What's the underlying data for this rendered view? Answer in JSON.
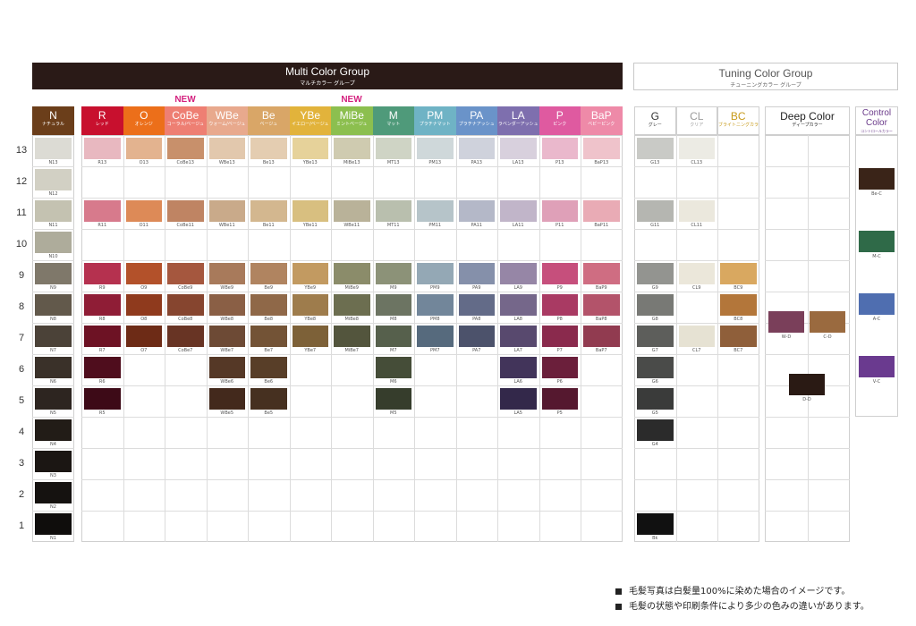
{
  "multi": {
    "title": "Multi Color Group",
    "subtitle": "マルチカラー グループ",
    "groups": [
      {
        "code": "N",
        "jp": "ナチュラル",
        "color": "#6b3e1a",
        "textColor": "#ffffff"
      },
      {
        "code": "R",
        "jp": "レッド",
        "color": "#c8102e",
        "textColor": "#ffffff"
      },
      {
        "code": "O",
        "jp": "オレンジ",
        "color": "#ec6f1a",
        "textColor": "#ffffff"
      },
      {
        "code": "CoBe",
        "jp": "コーラル/ベージュ",
        "color": "#ee7f73",
        "textColor": "#ffffff"
      },
      {
        "code": "WBe",
        "jp": "ウォーム/ベージュ",
        "color": "#e8a98d",
        "textColor": "#ffffff"
      },
      {
        "code": "Be",
        "jp": "ベージュ",
        "color": "#d9a667",
        "textColor": "#ffffff"
      },
      {
        "code": "YBe",
        "jp": "イエロー/ベージュ",
        "color": "#e2b33b",
        "textColor": "#ffffff"
      },
      {
        "code": "MiBe",
        "jp": "ミントベージュ",
        "color": "#8cbf4f",
        "textColor": "#ffffff"
      },
      {
        "code": "M",
        "jp": "マット",
        "color": "#4f9a7a",
        "textColor": "#ffffff"
      },
      {
        "code": "PM",
        "jp": "プラチナマット",
        "color": "#6fb3c5",
        "textColor": "#ffffff"
      },
      {
        "code": "PA",
        "jp": "プラチナアッシュ",
        "color": "#6a93c9",
        "textColor": "#ffffff"
      },
      {
        "code": "LA",
        "jp": "ラベンダーアッシュ",
        "color": "#7e6fae",
        "textColor": "#ffffff"
      },
      {
        "code": "P",
        "jp": "ピンク",
        "color": "#df5aa0",
        "textColor": "#ffffff"
      },
      {
        "code": "BaP",
        "jp": "ベビーピンク",
        "color": "#ee8aa8",
        "textColor": "#ffffff"
      }
    ],
    "new_labels": [
      "NEW",
      "NEW"
    ],
    "rows": [
      {
        "level": "13",
        "cells": [
          {
            "label": "N13",
            "color": "#dcdbd4"
          },
          {
            "label": "R13",
            "color": "#e8b8c0"
          },
          {
            "label": "O13",
            "color": "#e3b38f"
          },
          {
            "label": "CoBe13",
            "color": "#c8906b"
          },
          {
            "label": "WBe13",
            "color": "#e2c8ad"
          },
          {
            "label": "Be13",
            "color": "#e4cdb1"
          },
          {
            "label": "YBe13",
            "color": "#e6d29a"
          },
          {
            "label": "MiBe13",
            "color": "#cfcbb0"
          },
          {
            "label": "MT13",
            "color": "#cfd4c5"
          },
          {
            "label": "PM13",
            "color": "#cfd8da"
          },
          {
            "label": "PA13",
            "color": "#cfd2dc"
          },
          {
            "label": "LA13",
            "color": "#d8d0dd"
          },
          {
            "label": "P13",
            "color": "#eab8cc"
          },
          {
            "label": "BaP13",
            "color": "#efc3cb"
          }
        ]
      },
      {
        "level": "12",
        "cells": [
          {
            "label": "N12",
            "color": "#d2d0c4"
          },
          null,
          null,
          null,
          null,
          null,
          null,
          null,
          null,
          null,
          null,
          null,
          null,
          null
        ]
      },
      {
        "level": "11",
        "cells": [
          {
            "label": "N11",
            "color": "#c4c2b1"
          },
          {
            "label": "R11",
            "color": "#d77a8c"
          },
          {
            "label": "O11",
            "color": "#dd8a57"
          },
          {
            "label": "CoBe11",
            "color": "#bf8463"
          },
          {
            "label": "WBe11",
            "color": "#c9aa8a"
          },
          {
            "label": "Be11",
            "color": "#d3b78f"
          },
          {
            "label": "YBe11",
            "color": "#d8bf80"
          },
          {
            "label": "WBe11",
            "color": "#b9b299"
          },
          {
            "label": "MT11",
            "color": "#b9bfae"
          },
          {
            "label": "PM11",
            "color": "#b6c4c9"
          },
          {
            "label": "PA11",
            "color": "#b4b8c8"
          },
          {
            "label": "LA11",
            "color": "#c1b5c9"
          },
          {
            "label": "P11",
            "color": "#dfa0b8"
          },
          {
            "label": "BaP11",
            "color": "#e9abb5"
          }
        ]
      },
      {
        "level": "10",
        "cells": [
          {
            "label": "N10",
            "color": "#aeac9b"
          },
          null,
          null,
          null,
          null,
          null,
          null,
          null,
          null,
          null,
          null,
          null,
          null,
          null
        ]
      },
      {
        "level": "9",
        "cells": [
          {
            "label": "N9",
            "color": "#7f786a"
          },
          {
            "label": "R9",
            "color": "#b5314f"
          },
          {
            "label": "O9",
            "color": "#b3512a"
          },
          {
            "label": "CoBe9",
            "color": "#a5573e"
          },
          {
            "label": "WBe9",
            "color": "#a87a5b"
          },
          {
            "label": "Be9",
            "color": "#b08460"
          },
          {
            "label": "YBe9",
            "color": "#c29a61"
          },
          {
            "label": "MiBe9",
            "color": "#8b8c6a"
          },
          {
            "label": "M9",
            "color": "#8c9278"
          },
          {
            "label": "PM9",
            "color": "#94a8b5"
          },
          {
            "label": "PA9",
            "color": "#8590aa"
          },
          {
            "label": "LA9",
            "color": "#9686a6"
          },
          {
            "label": "P9",
            "color": "#c64f7c"
          },
          {
            "label": "BaP9",
            "color": "#cf6d82"
          }
        ]
      },
      {
        "level": "8",
        "cells": [
          {
            "label": "N8",
            "color": "#62594b"
          },
          {
            "label": "R8",
            "color": "#8f1d36"
          },
          {
            "label": "O8",
            "color": "#8f3a1d"
          },
          {
            "label": "CoBe8",
            "color": "#86452f"
          },
          {
            "label": "WBe8",
            "color": "#8a5f45"
          },
          {
            "label": "Be8",
            "color": "#8f6848"
          },
          {
            "label": "YBe8",
            "color": "#9e7c4c"
          },
          {
            "label": "MiBe8",
            "color": "#6c6e50"
          },
          {
            "label": "M8",
            "color": "#6c7462"
          },
          {
            "label": "PM8",
            "color": "#72869a"
          },
          {
            "label": "PA8",
            "color": "#636b88"
          },
          {
            "label": "LA8",
            "color": "#75678a"
          },
          {
            "label": "P8",
            "color": "#a93a63"
          },
          {
            "label": "BaP8",
            "color": "#b3536a"
          }
        ]
      },
      {
        "level": "7",
        "cells": [
          {
            "label": "N7",
            "color": "#4b4238"
          },
          {
            "label": "R7",
            "color": "#6d1224"
          },
          {
            "label": "O7",
            "color": "#6d2b16"
          },
          {
            "label": "CoBe7",
            "color": "#683424"
          },
          {
            "label": "WBe7",
            "color": "#6d4a35"
          },
          {
            "label": "Be7",
            "color": "#735336"
          },
          {
            "label": "YBe7",
            "color": "#7d6138"
          },
          {
            "label": "MiBe7",
            "color": "#53553d"
          },
          {
            "label": "M7",
            "color": "#56604c"
          },
          {
            "label": "PM7",
            "color": "#566a7d"
          },
          {
            "label": "PA7",
            "color": "#4c526b"
          },
          {
            "label": "LA7",
            "color": "#58496e"
          },
          {
            "label": "P7",
            "color": "#8a2a4d"
          },
          {
            "label": "BaP7",
            "color": "#913b50"
          }
        ]
      },
      {
        "level": "6",
        "cells": [
          {
            "label": "N6",
            "color": "#3a3129"
          },
          {
            "label": "R6",
            "color": "#4f0d1d"
          },
          null,
          null,
          {
            "label": "WBe6",
            "color": "#553826"
          },
          {
            "label": "Be6",
            "color": "#583e28"
          },
          null,
          null,
          {
            "label": "M6",
            "color": "#454d38"
          },
          null,
          null,
          {
            "label": "LA6",
            "color": "#42345a"
          },
          {
            "label": "P6",
            "color": "#6b1f3b"
          },
          null
        ]
      },
      {
        "level": "5",
        "cells": [
          {
            "label": "N5",
            "color": "#2d2520"
          },
          {
            "label": "R5",
            "color": "#3d0a17"
          },
          null,
          null,
          {
            "label": "WBe5",
            "color": "#43291c"
          },
          {
            "label": "Be5",
            "color": "#463020"
          },
          null,
          null,
          {
            "label": "M5",
            "color": "#363d2c"
          },
          null,
          null,
          {
            "label": "LA5",
            "color": "#33284a"
          },
          {
            "label": "P5",
            "color": "#55182f"
          },
          null
        ]
      },
      {
        "level": "4",
        "cells": [
          {
            "label": "N4",
            "color": "#221c17"
          },
          null,
          null,
          null,
          null,
          null,
          null,
          null,
          null,
          null,
          null,
          null,
          null,
          null
        ]
      },
      {
        "level": "3",
        "cells": [
          {
            "label": "N3",
            "color": "#1b1613"
          },
          null,
          null,
          null,
          null,
          null,
          null,
          null,
          null,
          null,
          null,
          null,
          null,
          null
        ]
      },
      {
        "level": "2",
        "cells": [
          {
            "label": "N2",
            "color": "#151210"
          },
          null,
          null,
          null,
          null,
          null,
          null,
          null,
          null,
          null,
          null,
          null,
          null,
          null
        ]
      },
      {
        "level": "1",
        "cells": [
          {
            "label": "N1",
            "color": "#0f0d0c"
          },
          null,
          null,
          null,
          null,
          null,
          null,
          null,
          null,
          null,
          null,
          null,
          null,
          null
        ]
      }
    ]
  },
  "tuning": {
    "title": "Tuning Color Group",
    "subtitle": "チューニングカラー グループ",
    "groups": [
      {
        "code": "G",
        "jp": "グレー",
        "textColor": "#333333"
      },
      {
        "code": "CL",
        "jp": "クリア",
        "textColor": "#9a9a9a"
      },
      {
        "code": "BC",
        "jp": "ブライトニングカラー",
        "textColor": "#c79a1a"
      }
    ],
    "rows": [
      [
        {
          "label": "G13",
          "color": "#c9cac6"
        },
        {
          "label": "CL13",
          "color": "#ecebe4"
        },
        null
      ],
      [
        null,
        null,
        null
      ],
      [
        {
          "label": "G11",
          "color": "#b5b6b1"
        },
        {
          "label": "CL11",
          "color": "#ebe8dd"
        },
        null
      ],
      [
        null,
        null,
        null
      ],
      [
        {
          "label": "G9",
          "color": "#939490"
        },
        {
          "label": "CL9",
          "color": "#ebe7da"
        },
        {
          "label": "BC9",
          "color": "#d9a860"
        }
      ],
      [
        {
          "label": "G8",
          "color": "#787975"
        },
        null,
        {
          "label": "BC8",
          "color": "#b3763a"
        }
      ],
      [
        {
          "label": "G7",
          "color": "#5d5e5b"
        },
        {
          "label": "CL7",
          "color": "#e6e2d3"
        },
        {
          "label": "BC7",
          "color": "#8f5f3a"
        }
      ],
      [
        {
          "label": "G6",
          "color": "#4a4b49"
        },
        null,
        null
      ],
      [
        {
          "label": "G5",
          "color": "#3a3b3a"
        },
        null,
        null
      ],
      [
        {
          "label": "G4",
          "color": "#2b2b2b"
        },
        null,
        null
      ],
      [
        null,
        null,
        null
      ],
      [
        null,
        null,
        null
      ],
      [
        {
          "label": "Bk",
          "color": "#111111"
        },
        null,
        null
      ]
    ]
  },
  "deep": {
    "title": "Deep Color",
    "jp": "ディープカラー",
    "swatches": [
      {
        "label": "W-D",
        "color": "#7a3f5a"
      },
      {
        "label": "C-D",
        "color": "#9a6a3f"
      },
      {
        "label": "D-D",
        "color": "#2a1a14"
      }
    ]
  },
  "control": {
    "title_line1": "Control",
    "title_line2": "Color",
    "jp": "コントロールカラー",
    "titleColor": "#6a3a8a",
    "swatches": [
      {
        "label": "Be-C",
        "color": "#3a2418"
      },
      {
        "label": "M-C",
        "color": "#2f6a48"
      },
      {
        "label": "A-C",
        "color": "#4f6eb0"
      },
      {
        "label": "V-C",
        "color": "#6a3a8f"
      }
    ]
  },
  "notes": [
    "毛髪写真は白髪量100%に染めた場合のイメージです。",
    "毛髪の状態や印刷条件により多少の色みの違いがあります。"
  ]
}
